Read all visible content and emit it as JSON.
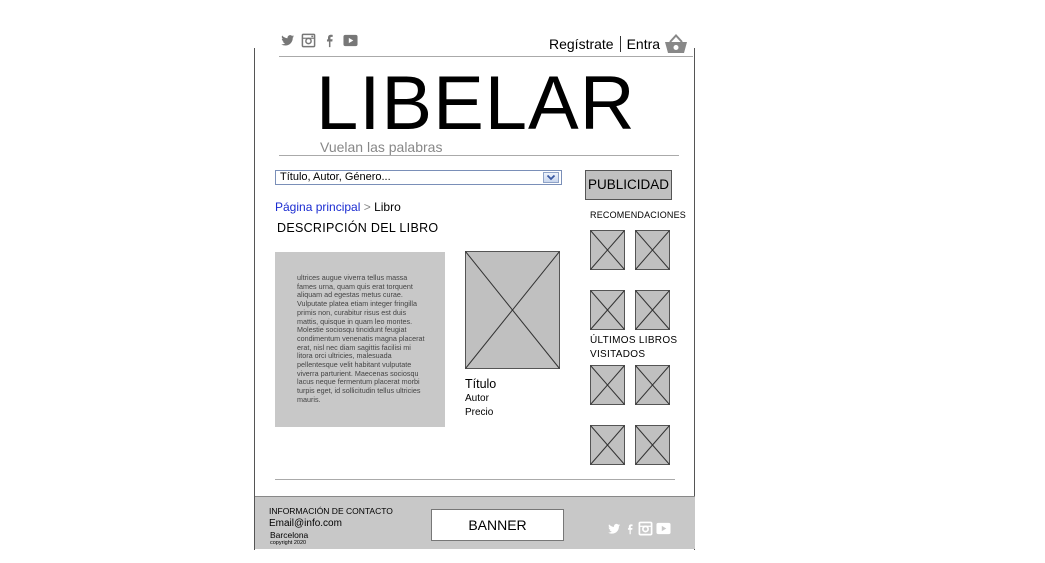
{
  "header": {
    "social_icons": [
      "twitter-icon",
      "instagram-icon",
      "facebook-icon",
      "youtube-icon"
    ],
    "register_label": "Regístrate",
    "login_label": "Entra",
    "cart_icon": "basket-icon",
    "logo": "LIBELAR",
    "tagline": "Vuelan las palabras"
  },
  "search": {
    "value": "Título, Autor, Género..."
  },
  "breadcrumb": {
    "home": "Página principal",
    "separator": ">",
    "current": "Libro"
  },
  "main": {
    "section_title": "DESCRIPCIÓN DEL LIBRO",
    "description": "ultrices augue viverra tellus massa fames urna, quam quis erat torquent aliquam ad egestas metus curae. Vulputate platea etiam integer fringilla primis non, curabitur risus est duis mattis, quisque in quam leo montes. Molestie sociosqu tincidunt feugiat condimentum venenatis magna placerat erat, nisl nec diam sagittis facilisi mi litora orci ultricies, malesuada pellentesque velit habitant vulputate viverra parturient. Maecenas sociosqu lacus neque fermentum placerat morbi turpis eget, id sollicitudin tellus ultricies mauris.",
    "book": {
      "title": "Título",
      "author": "Autor",
      "price": "Precio"
    }
  },
  "sidebar": {
    "ad_label": "PUBLICIDAD",
    "recommendations_title": "RECOMENDACIONES",
    "recently_viewed_title": "ÚLTIMOS LIBROS VISITADOS"
  },
  "footer": {
    "contact_title": "INFORMACIÓN DE CONTACTO",
    "email": "Email@info.com",
    "city": "Barcelona",
    "copyright": "copyright 2020",
    "banner_label": "BANNER",
    "social_icons": [
      "twitter-icon",
      "facebook-icon",
      "instagram-icon",
      "youtube-icon"
    ]
  },
  "colors": {
    "link": "#1a2bd1",
    "placeholder_gray": "#c0c0c0"
  }
}
